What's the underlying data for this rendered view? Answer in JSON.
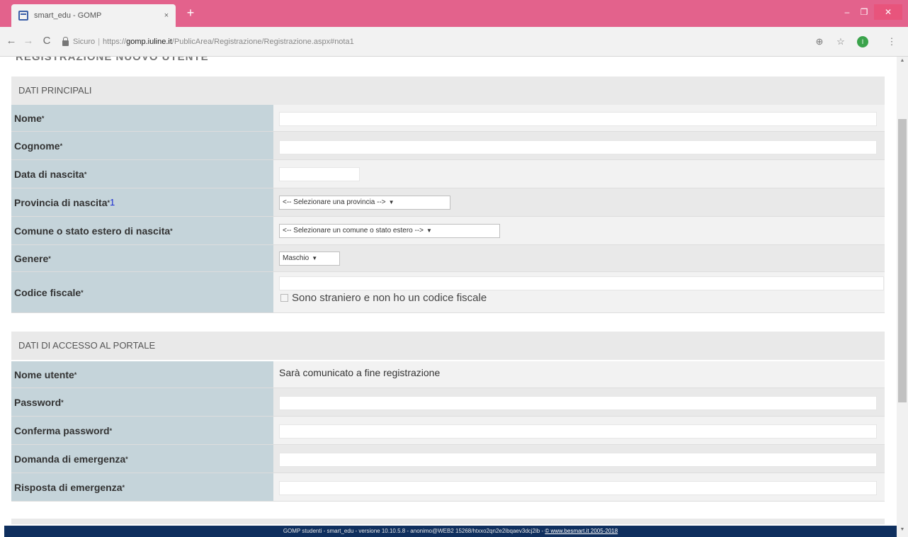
{
  "browser": {
    "tab_title": "smart_edu - GOMP",
    "tab_close": "×",
    "new_tab": "+",
    "window_controls": {
      "minimize": "‒",
      "maximize": "❐",
      "close": "✕"
    },
    "nav": {
      "back": "←",
      "forward": "→",
      "reload": "C"
    },
    "secure_label": "Sicuro",
    "separator": "|",
    "url_prefix": "https://",
    "url_host": "gomp.iuline.it",
    "url_path": "/PublicArea/Registrazione/Registrazione.aspx#nota1",
    "toolbar_icons": {
      "zoom": "⊕",
      "star": "☆",
      "extension": "I",
      "menu": "⋮"
    }
  },
  "page": {
    "heading": "REGISTRAZIONE NUOVO UTENTE",
    "sections": {
      "main": {
        "title": "DATI PRINCIPALI",
        "fields": {
          "nome": {
            "label": "Nome",
            "required": "*",
            "value": ""
          },
          "cognome": {
            "label": "Cognome",
            "required": "*",
            "value": ""
          },
          "data_nascita": {
            "label": "Data di nascita",
            "required": "*",
            "value": ""
          },
          "provincia": {
            "label": "Provincia di nascita",
            "required": "*",
            "note": "1",
            "selected": "<-- Selezionare una provincia -->"
          },
          "comune": {
            "label": "Comune o stato estero di nascita",
            "required": "*",
            "selected": "<-- Selezionare un comune o stato estero -->"
          },
          "genere": {
            "label": "Genere",
            "required": "*",
            "selected": "Maschio"
          },
          "codice_fiscale": {
            "label": "Codice fiscale",
            "required": "*",
            "value": "",
            "checkbox_label": "Sono straniero e non ho un codice fiscale"
          }
        }
      },
      "access": {
        "title": "DATI DI ACCESSO AL PORTALE",
        "fields": {
          "nome_utente": {
            "label": "Nome utente",
            "required": "*",
            "value": "Sarà comunicato a fine registrazione"
          },
          "password": {
            "label": "Password",
            "required": "*",
            "value": ""
          },
          "conferma_password": {
            "label": "Conferma password",
            "required": "*",
            "value": ""
          },
          "domanda": {
            "label": "Domanda di emergenza",
            "required": "*",
            "value": ""
          },
          "risposta": {
            "label": "Risposta di emergenza",
            "required": "*",
            "value": ""
          }
        }
      }
    },
    "select_chevron": "▼"
  },
  "footer": {
    "text": "GOMP studenti - smart_edu - versione 10.10.5.8 - anonimo@WEB2 15268/htxxo2qn2e2ibqaev3dcj2ib - ",
    "link": "© www.besmart.it 2005-2018"
  },
  "scrollbar": {
    "up": "▲",
    "down": "▼"
  }
}
